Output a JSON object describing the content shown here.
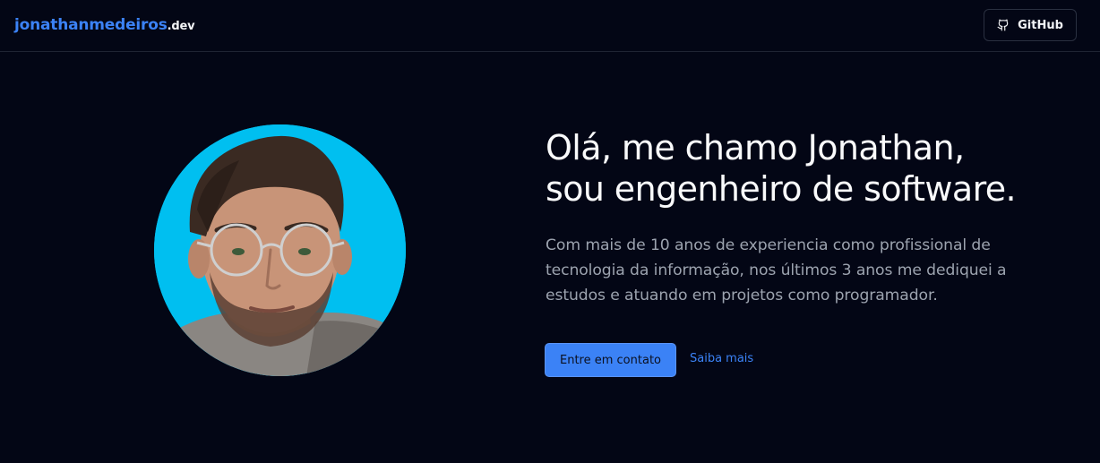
{
  "header": {
    "logo_name": "jonathanmedeiros",
    "logo_tld": ".dev",
    "github_label": "GitHub"
  },
  "hero": {
    "title_line1": "Olá, me chamo Jonathan,",
    "title_line2": "sou engenheiro de software.",
    "description_lines": [
      "Com mais de 10 anos de experiencia como profissional de",
      "tecnologia da informação, nos últimos 3 anos me dediquei a",
      "estudos e atuando em projetos como programador."
    ],
    "contact_button": "Entre em contato",
    "more_link": "Saiba mais"
  },
  "colors": {
    "background": "#030615",
    "accent": "#3b82f6",
    "avatar_bg": "#00bff0",
    "muted_text": "#9ca3af"
  },
  "icons": {
    "github": "github-icon"
  }
}
